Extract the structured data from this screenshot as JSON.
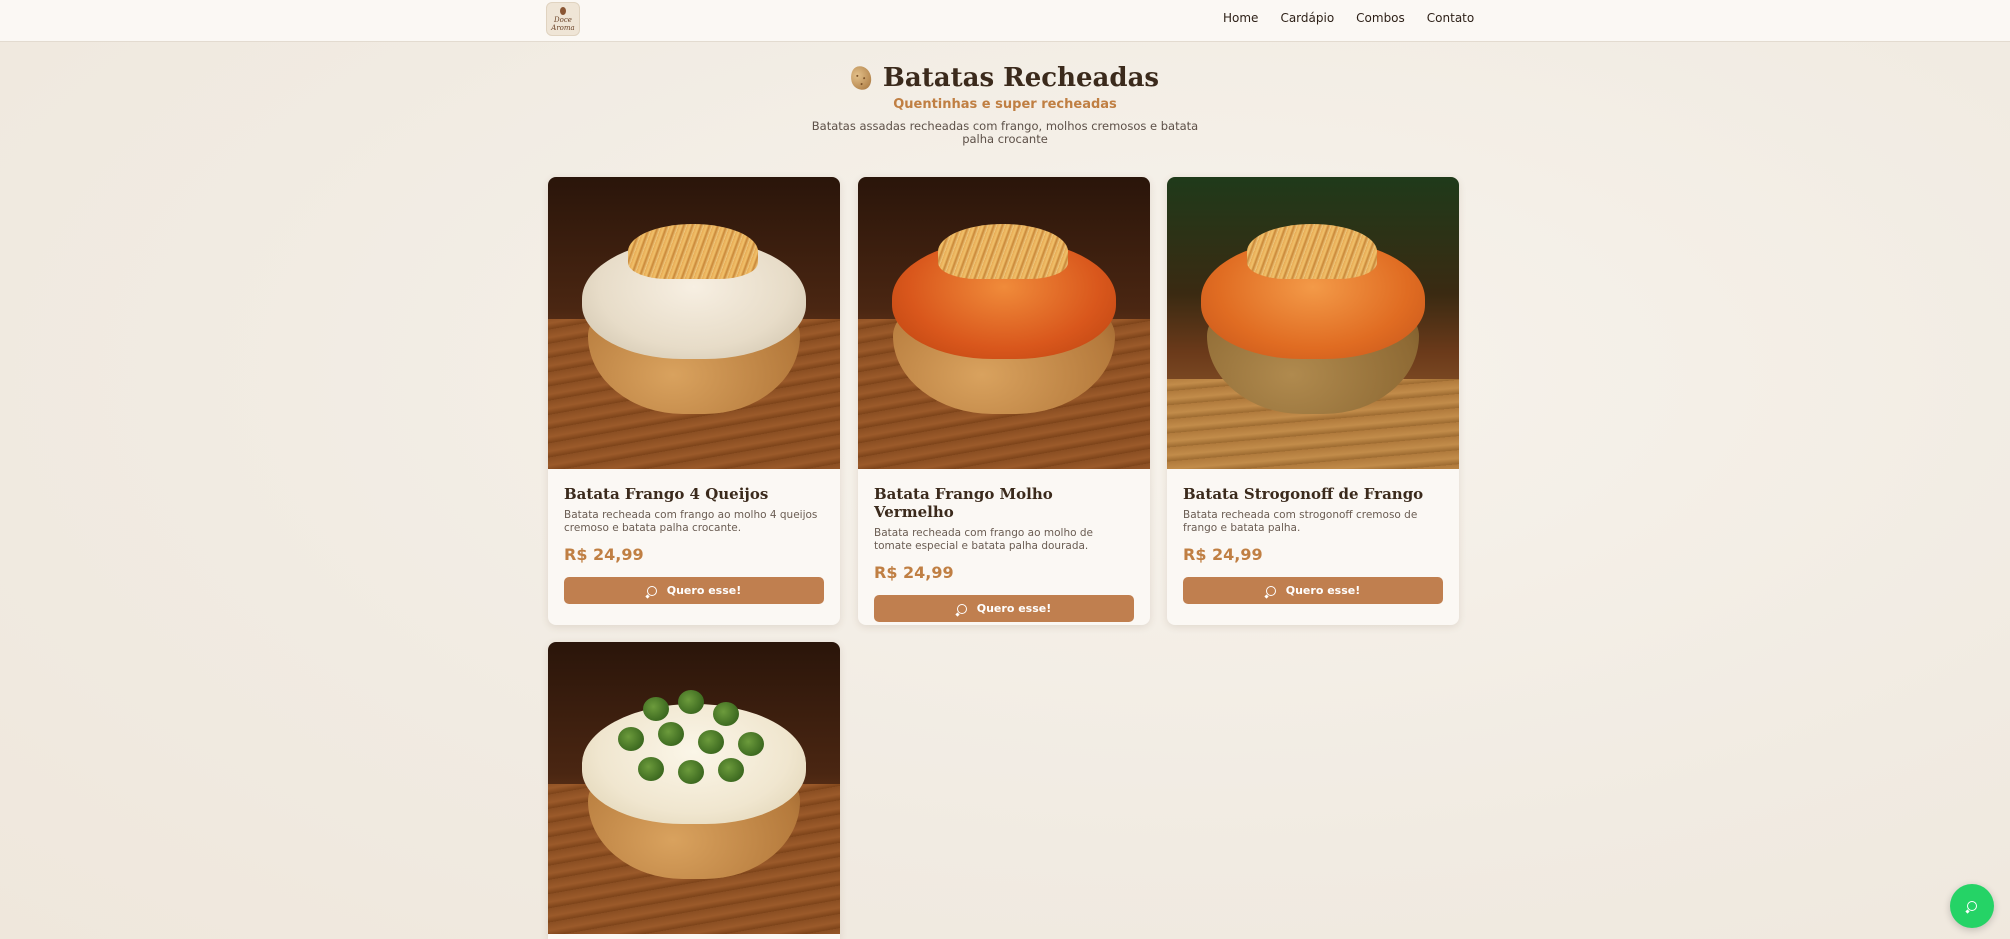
{
  "nav": {
    "logo_text": "Doce Aroma",
    "links": [
      "Home",
      "Cardápio",
      "Combos",
      "Contato"
    ]
  },
  "header": {
    "title": "Batatas Recheadas",
    "subtitle": "Quentinhas e super recheadas",
    "description": "Batatas assadas recheadas com frango, molhos cremosos e batata palha crocante"
  },
  "products": [
    {
      "name": "Batata Frango 4 Queijos",
      "description": "Batata recheada com frango ao molho 4 queijos cremoso e batata palha crocante.",
      "price": "R$ 24,99",
      "button": "Quero esse!"
    },
    {
      "name": "Batata Frango Molho Vermelho",
      "description": "Batata recheada com frango ao molho de tomate especial e batata palha dourada.",
      "price": "R$ 24,99",
      "button": "Quero esse!"
    },
    {
      "name": "Batata Strogonoff de Frango",
      "description": "Batata recheada com strogonoff cremoso de frango e batata palha.",
      "price": "R$ 24,99",
      "button": "Quero esse!"
    }
  ],
  "colors": {
    "accent": "#c07f43",
    "button": "#c07f4f",
    "whatsapp": "#25d366"
  }
}
